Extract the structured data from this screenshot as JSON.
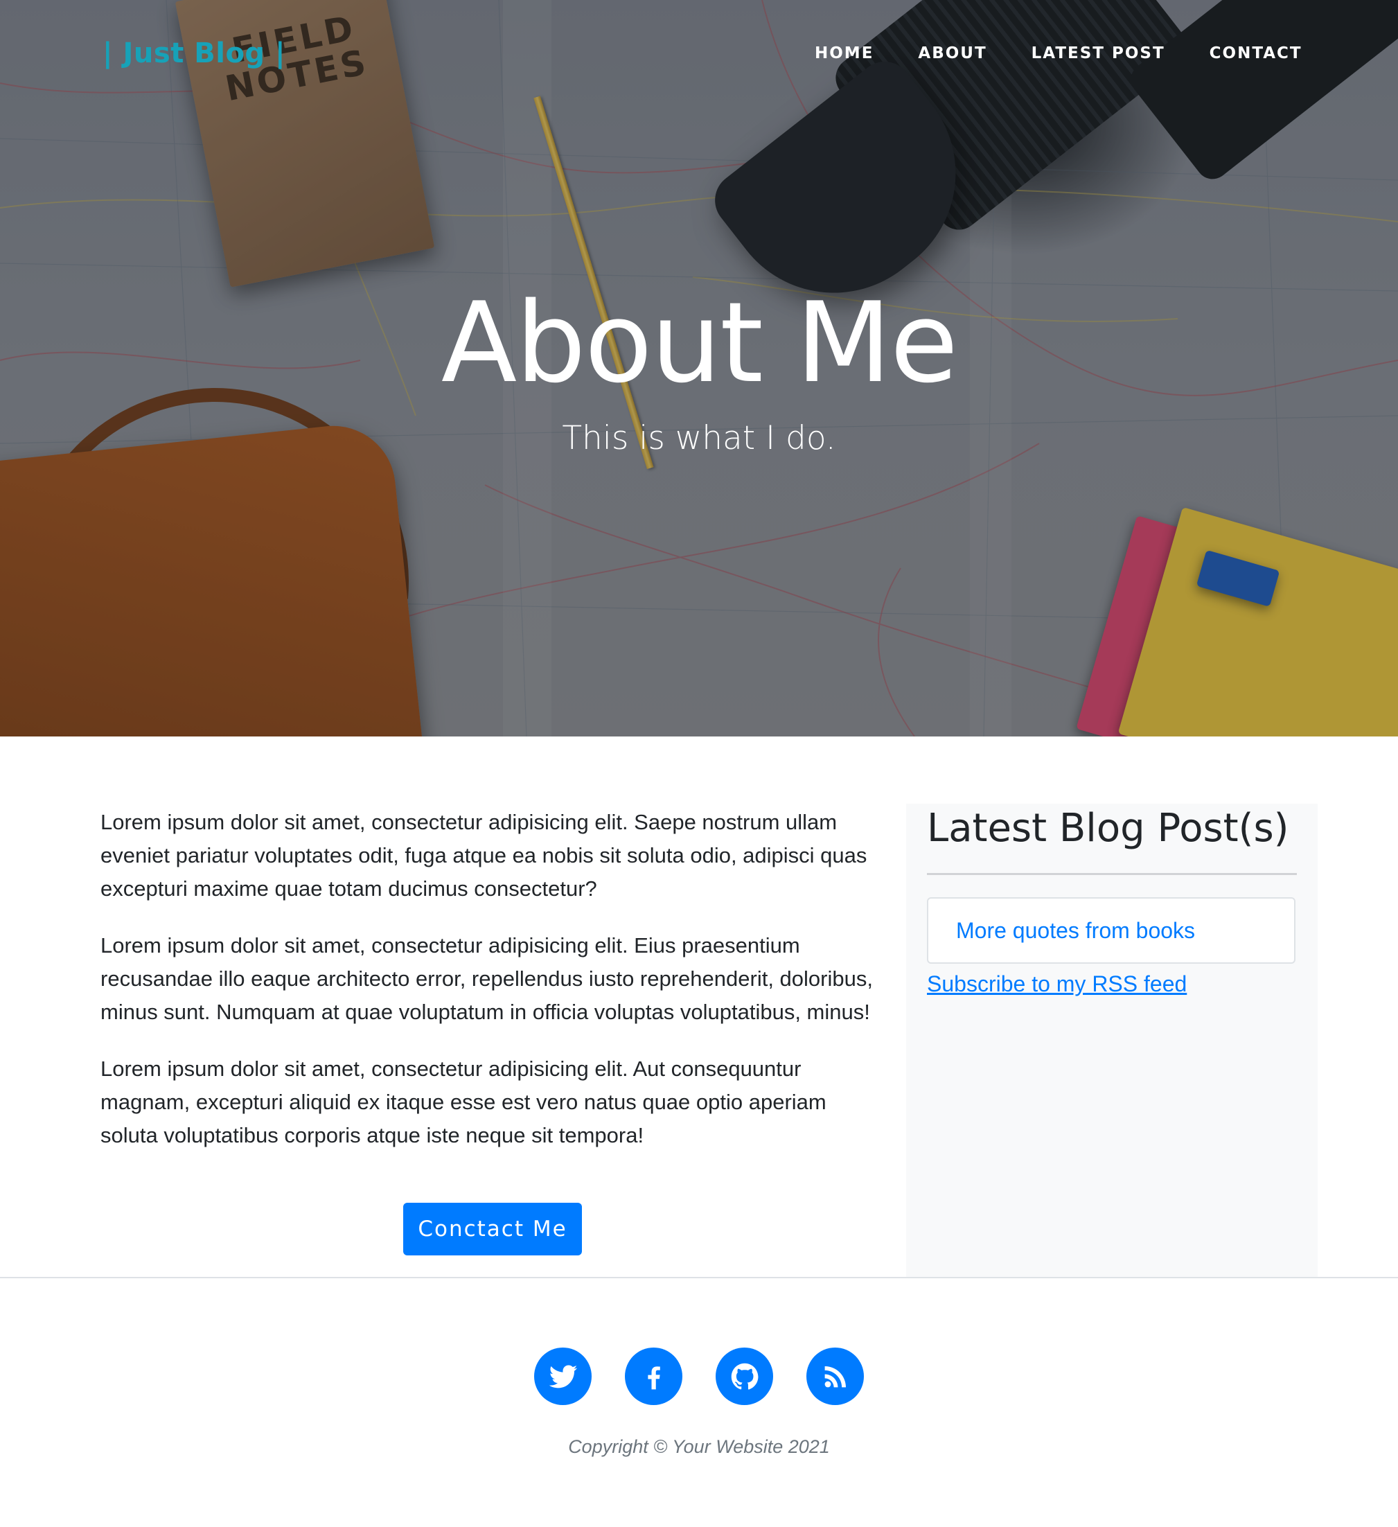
{
  "brand": {
    "name": "| Just Blog |",
    "color": "#17a2b8"
  },
  "nav": {
    "items": [
      {
        "label": "HOME"
      },
      {
        "label": "ABOUT"
      },
      {
        "label": "LATEST POST"
      },
      {
        "label": "CONTACT"
      }
    ]
  },
  "hero": {
    "title": "About Me",
    "subtitle": "This is what I do.",
    "notebook_text": "FIELD NOTES"
  },
  "main": {
    "paragraphs": [
      "Lorem ipsum dolor sit amet, consectetur adipisicing elit. Saepe nostrum ullam eveniet pariatur voluptates odit, fuga atque ea nobis sit soluta odio, adipisci quas excepturi maxime quae totam ducimus consectetur?",
      "Lorem ipsum dolor sit amet, consectetur adipisicing elit. Eius praesentium recusandae illo eaque architecto error, repellendus iusto reprehenderit, doloribus, minus sunt. Numquam at quae voluptatum in officia voluptas voluptatibus, minus!",
      "Lorem ipsum dolor sit amet, consectetur adipisicing elit. Aut consequuntur magnam, excepturi aliquid ex itaque esse est vero natus quae optio aperiam soluta voluptatibus corporis atque iste neque sit tempora!"
    ],
    "contact_button": "Conctact Me"
  },
  "sidebar": {
    "title": "Latest Blog Post(s)",
    "posts": [
      {
        "title": "More quotes from books"
      }
    ],
    "rss_label": "Subscribe to my RSS feed"
  },
  "footer": {
    "social": [
      {
        "icon": "twitter-icon"
      },
      {
        "icon": "facebook-icon"
      },
      {
        "icon": "github-icon"
      },
      {
        "icon": "rss-icon"
      }
    ],
    "copyright": "Copyright © Your Website 2021"
  },
  "colors": {
    "primary": "#007bff",
    "sidebar_bg": "#f8f9fa",
    "muted": "#6c757d"
  }
}
